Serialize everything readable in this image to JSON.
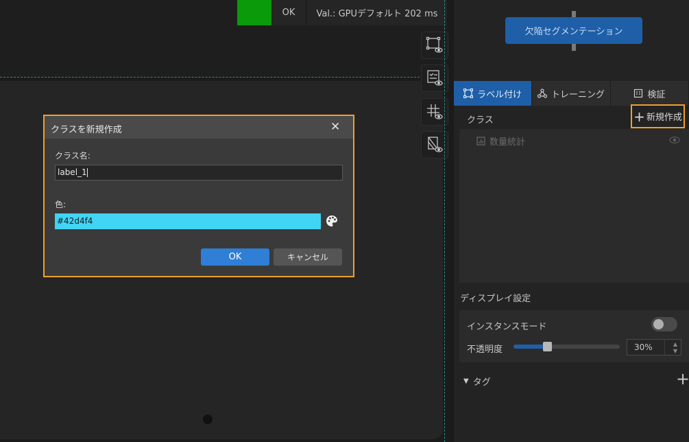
{
  "status": {
    "result": "OK",
    "validation": "Val.: GPUデフォルト 202 ms",
    "color_ok": "#0a9a0a"
  },
  "toolbar": {
    "icons": [
      "polygon-view-icon",
      "checklist-view-icon",
      "grid-view-icon",
      "layer-view-icon"
    ]
  },
  "workflow": {
    "module_label": "欠陥セグメンテーション"
  },
  "tabs": [
    {
      "label": "ラベル付け",
      "icon": "label-icon",
      "active": true
    },
    {
      "label": "トレーニング",
      "icon": "training-icon",
      "active": false
    },
    {
      "label": "検証",
      "icon": "verify-icon",
      "active": false
    }
  ],
  "classes": {
    "title": "クラス",
    "new_button": "新規作成",
    "stats_label": "数量統計"
  },
  "display": {
    "title": "ディスプレイ設定",
    "instance_mode": "インスタンスモード",
    "opacity_label": "不透明度",
    "opacity_value": "30%",
    "opacity_fraction": 0.3
  },
  "tags": {
    "title": "タグ"
  },
  "dialog": {
    "title": "クラスを新規作成",
    "name_label": "クラス名:",
    "name_value": "label_1",
    "color_label": "色:",
    "color_value": "#42d4f4",
    "ok_label": "OK",
    "cancel_label": "キャンセル",
    "accent": "#f0a030"
  }
}
